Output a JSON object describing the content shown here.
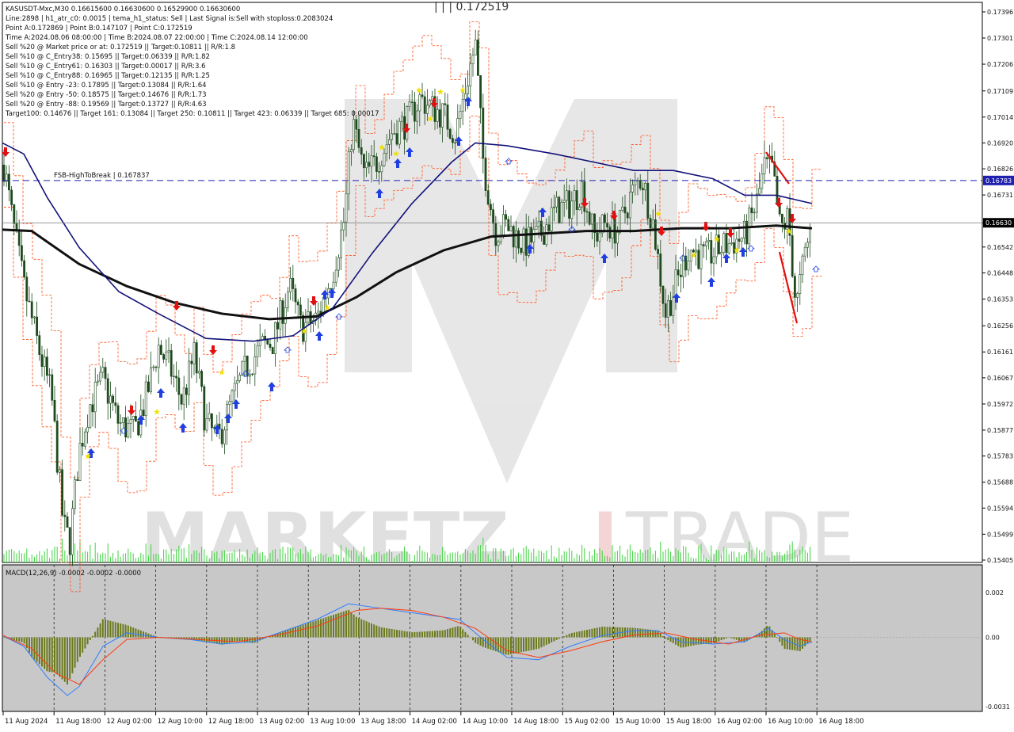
{
  "header": {
    "symbol_line": "KASUSDT-Mxc,M30  0.16615600 0.16630600 0.16529900 0.16630600",
    "info_lines": [
      "Line:2898  |  h1_atr_c0: 0.0015  |  tema_h1_status: Sell  |  Last Signal is:Sell with stoploss:0.2083024",
      "Point A:0.172869  |  Point B:0.147107  |  Point C:0.172519",
      "Time A:2024.08.06 08:00:00  |  Time B:2024.08.07 22:00:00  |  Time C:2024.08.14 12:00:00",
      "Sell %20 @ Market price or at: 0.172519  ||  Target:0.10811  ||  R/R:1.8",
      "Sell %10 @ C_Entry38: 0.15695  ||  Target:0.06339  ||  R/R:1.82",
      "Sell %10 @ C_Entry61: 0.16303  ||  Target:0.00017  ||  R/R:3.6",
      "Sell %10 @ C_Entry88: 0.16965  ||  Target:0.12135  ||  R/R:1.25",
      "Sell %10 @ Entry -23: 0.17895  ||  Target:0.13084  ||  R/R:1.64",
      "Sell %20 @ Entry -50: 0.18575  ||  Target:0.14676  ||  R/R:1.73",
      "Sell %20 @ Entry -88: 0.19569  ||  Target:0.13727  ||  R/R:4.63",
      "Target100: 0.14676  ||  Target 161: 0.13084  ||  Target 250: 0.10811  ||  Target 423: 0.06339  ||  Target 685: 0.00017"
    ],
    "top_label": "| | | 0.172519"
  },
  "fsb_label": "FSB-HighToBreak  |  0.167837",
  "macd_label": "MACD(12,26,9) -0.0002 -0.0002 -0.0000",
  "watermark": {
    "left": "MARKETZ",
    "mid": "I",
    "right": "TRADE"
  },
  "chart_data": {
    "type": "candlestick",
    "symbol": "KASUSDT-Mxc",
    "timeframe": "M30",
    "main_axis_ticks": [
      "0.17396",
      "0.17301",
      "0.17206",
      "0.17109",
      "0.17014",
      "0.16920",
      "0.16826",
      "0.16731",
      "0.16630",
      "0.16542",
      "0.16448",
      "0.16353",
      "0.16256",
      "0.16161",
      "0.16067",
      "0.15972",
      "0.15877",
      "0.15783",
      "0.15688",
      "0.15594",
      "0.15499",
      "0.15405"
    ],
    "main_ylim": [
      0.15405,
      0.17396
    ],
    "current_price": {
      "label": "0.16630",
      "value": 0.1663
    },
    "fsb_level": {
      "label": "0.16783",
      "value": 0.167837
    },
    "x_labels": [
      "11 Aug 2024",
      "11 Aug 18:00",
      "12 Aug 02:00",
      "12 Aug 10:00",
      "12 Aug 18:00",
      "13 Aug 02:00",
      "13 Aug 10:00",
      "13 Aug 18:00",
      "14 Aug 02:00",
      "14 Aug 10:00",
      "14 Aug 18:00",
      "15 Aug 02:00",
      "15 Aug 10:00",
      "15 Aug 18:00",
      "16 Aug 02:00",
      "16 Aug 10:00",
      "16 Aug 18:00"
    ],
    "macd_ticks": [
      "0.002",
      "0.00",
      "-0.0031"
    ],
    "macd_ylim": [
      -0.0031,
      0.002
    ],
    "colors": {
      "background": "#ffffff",
      "candle": "#1d4a1d",
      "ma_slow": "#111111",
      "ma_fast": "#12127a",
      "envelope": "#ff4a10",
      "fsb_line": "#1f1fb0",
      "volume": "#3fd23f",
      "macd_hist": "#6b7a1c",
      "macd_line": "#2f7fff",
      "signal_line": "#ff3b10",
      "buy_arrow": "#1f3fe0",
      "sell_arrow": "#e01010",
      "star": "#f2e000",
      "price_tag": "#1f1fb0"
    },
    "series": [
      {
        "name": "MACD",
        "type": "histogram+lines",
        "values": [
          -0.0002,
          -0.0002,
          -0.0
        ]
      }
    ]
  }
}
